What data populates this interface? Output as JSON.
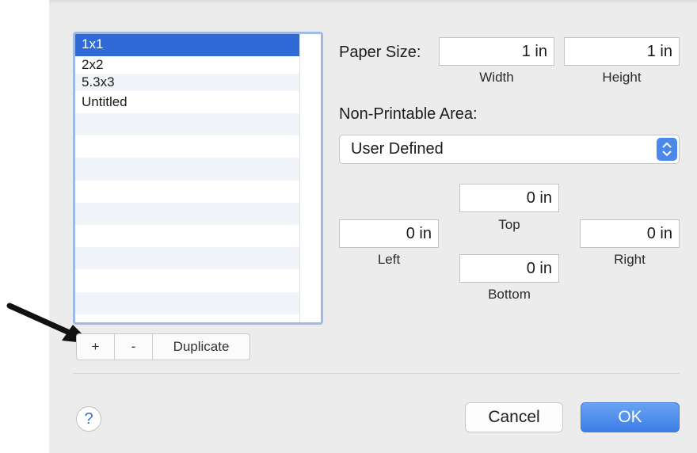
{
  "paper_list": {
    "items": [
      "1x1",
      "2x2",
      "5.3x3",
      "Untitled"
    ],
    "selected_index": 0
  },
  "controls": {
    "add_label": "+",
    "remove_label": "-",
    "duplicate_label": "Duplicate"
  },
  "paper_size": {
    "label": "Paper Size:",
    "width_value": "1 in",
    "width_caption": "Width",
    "height_value": "1 in",
    "height_caption": "Height"
  },
  "non_printable": {
    "label": "Non-Printable Area:",
    "selected_option": "User Defined",
    "top_value": "0 in",
    "top_caption": "Top",
    "left_value": "0 in",
    "left_caption": "Left",
    "right_value": "0 in",
    "right_caption": "Right",
    "bottom_value": "0 in",
    "bottom_caption": "Bottom"
  },
  "footer": {
    "help_label": "?",
    "cancel_label": "Cancel",
    "ok_label": "OK"
  },
  "colors": {
    "selection": "#2f6ad6",
    "ok_button": "#3c7fe8",
    "list_border": "#9dbbe4"
  }
}
